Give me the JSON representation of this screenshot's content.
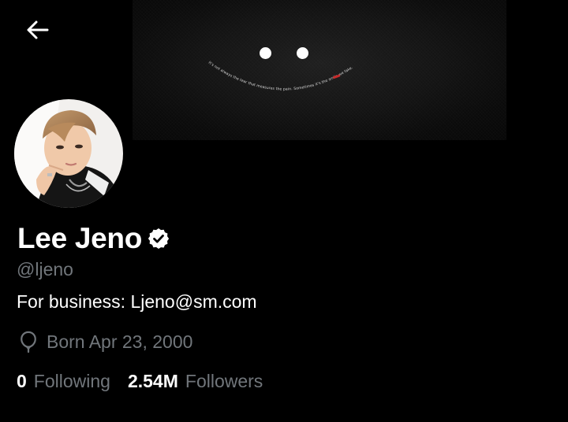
{
  "header": {
    "back_icon": "arrow-left-icon",
    "banner_caption": "It's not always the tear that measures the pain. Sometimes it's the smile we fake."
  },
  "profile": {
    "display_name": "Lee Jeno",
    "verified_icon": "verified-badge-icon",
    "handle": "@ljeno",
    "bio": "For business: Ljeno@sm.com",
    "birthday_icon": "balloon-icon",
    "birthday": "Born Apr 23, 2000"
  },
  "stats": {
    "following_count": "0",
    "following_label": "Following",
    "followers_count": "2.54M",
    "followers_label": "Followers"
  },
  "colors": {
    "background": "#000000",
    "primary_text": "#ffffff",
    "secondary_text": "#71767b",
    "banner_accent": "#c62828"
  }
}
